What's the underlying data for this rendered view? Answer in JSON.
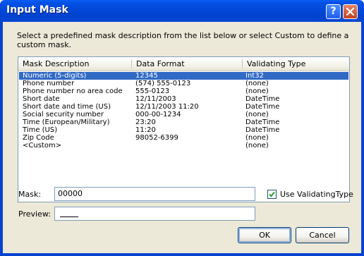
{
  "window": {
    "title": "Input Mask"
  },
  "titlebar_buttons": {
    "help": "?",
    "close": "close"
  },
  "description": "Select a predefined mask description from the list below or select Custom to define a custom mask.",
  "list": {
    "columns": [
      "Mask Description",
      "Data Format",
      "Validating Type"
    ],
    "rows": [
      {
        "desc": "Numeric (5-digits)",
        "format": "12345",
        "type": "Int32",
        "selected": true
      },
      {
        "desc": "Phone number",
        "format": "(574) 555-0123",
        "type": "(none)"
      },
      {
        "desc": "Phone number no area code",
        "format": "555-0123",
        "type": "(none)"
      },
      {
        "desc": "Short date",
        "format": "12/11/2003",
        "type": "DateTime"
      },
      {
        "desc": "Short date and time (US)",
        "format": "12/11/2003 11:20",
        "type": "DateTime"
      },
      {
        "desc": "Social security number",
        "format": "000-00-1234",
        "type": "(none)"
      },
      {
        "desc": "Time (European/Military)",
        "format": "23:20",
        "type": "DateTime"
      },
      {
        "desc": "Time (US)",
        "format": "11:20",
        "type": "DateTime"
      },
      {
        "desc": "Zip Code",
        "format": "98052-6399",
        "type": "(none)"
      },
      {
        "desc": "<Custom>",
        "format": "",
        "type": "(none)"
      }
    ]
  },
  "mask": {
    "label": "Mask:",
    "value": "00000"
  },
  "preview": {
    "label": "Preview:",
    "value": ""
  },
  "validating_checkbox": {
    "label": "Use ValidatingType",
    "checked": true
  },
  "buttons": {
    "ok": "OK",
    "cancel": "Cancel"
  },
  "colors": {
    "titlebar": "#0348d8",
    "selection": "#316ac5",
    "dialog_bg": "#ece9d8"
  }
}
